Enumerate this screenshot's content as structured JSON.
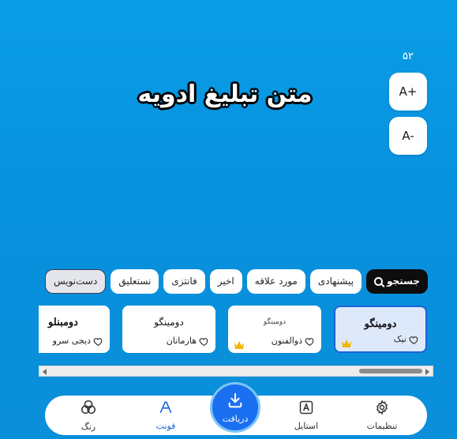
{
  "editor": {
    "preview_text": "متن تبلیغ ادویه",
    "font_size": "۵۲",
    "increase_label": "A+",
    "decrease_label": "A-"
  },
  "filters": {
    "search_label": "جستجو",
    "items": [
      "پیشنهادی",
      "مورد علاقه",
      "اخیر",
      "فانتزی",
      "نستعلیق",
      "دست‌نویس"
    ],
    "selected": "دست‌نویس"
  },
  "fonts": [
    {
      "sample": "دومینگو",
      "name": "نیک",
      "premium": true,
      "selected": true
    },
    {
      "sample": "دومینگو",
      "name": "ذوالفنون",
      "premium": true,
      "selected": false
    },
    {
      "sample": "دومینگو",
      "name": "هارماتان",
      "premium": false,
      "selected": false
    },
    {
      "sample": "دومبنلو",
      "name": "دیجی سرو",
      "premium": false,
      "selected": false
    }
  ],
  "bottom_nav": {
    "settings": "تنظیمات",
    "style": "استایل",
    "download": "دریافت",
    "font": "فونت",
    "color": "رنگ",
    "active": "فونت"
  },
  "colors": {
    "background": "#0a9de6",
    "accent": "#1a63d8",
    "download_button": "#1a6ff0",
    "crown": "#f2b705"
  }
}
